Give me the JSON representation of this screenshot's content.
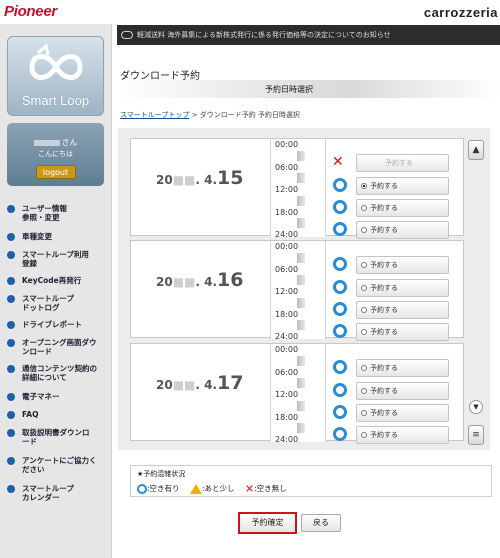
{
  "header": {
    "brand_left": "Pioneer",
    "brand_right": "carrozzeria"
  },
  "sidebar": {
    "logo_text": "Smart Loop",
    "user_suffix": "さん",
    "greeting": "こんにちは",
    "logout_label": "logout",
    "menu": [
      "ユーザー情報\n参照・変更",
      "車種変更",
      "スマートループ利用\n登録",
      "KeyCode再発行",
      "スマートループ\nドットログ",
      "ドライブレポート",
      "オープニング画面ダウ\nンロード",
      "通信コンテンツ契約の\n詳細について",
      "電子マネー",
      "FAQ",
      "取扱説明書ダウンロ\nード",
      "アンケートにご協力く\nださい",
      "スマートループ\nカレンダー"
    ]
  },
  "notice": "軽減送料 海外募集による新株式発行に係る発行価格等の決定についてのお知らせ",
  "page_title": "ダウンロード予約",
  "step_label": "予約日時選択",
  "breadcrumb": {
    "link": "スマートループトップ",
    "rest": "> ダウンロード予約 予約日時選択"
  },
  "ticks": [
    "00:00",
    "06:00",
    "12:00",
    "18:00",
    "24:00"
  ],
  "reserve_label": "予約する",
  "days": [
    {
      "prefix": "20",
      "suffix": ". 4.",
      "day": "15",
      "slots": [
        {
          "status": "unavailable",
          "selected": false
        },
        {
          "status": "available",
          "selected": true
        },
        {
          "status": "available",
          "selected": false
        },
        {
          "status": "available",
          "selected": false
        }
      ]
    },
    {
      "prefix": "20",
      "suffix": ". 4.",
      "day": "16",
      "slots": [
        {
          "status": "available",
          "selected": false
        },
        {
          "status": "available",
          "selected": false
        },
        {
          "status": "available",
          "selected": false
        },
        {
          "status": "available",
          "selected": false
        }
      ]
    },
    {
      "prefix": "20",
      "suffix": ". 4.",
      "day": "17",
      "slots": [
        {
          "status": "available",
          "selected": false
        },
        {
          "status": "available",
          "selected": false
        },
        {
          "status": "available",
          "selected": false
        },
        {
          "status": "available",
          "selected": false
        }
      ]
    }
  ],
  "legend": {
    "title": "★予約混雑状況",
    "available": ":空き有り",
    "few": ":あと少し",
    "none": ":空き無し"
  },
  "confirm_label": "予約確定",
  "back_label": "戻る",
  "colors": {
    "available": "#2a8bd6",
    "few": "#f0b400",
    "none": "#d41414",
    "brand": "#c8102e"
  }
}
